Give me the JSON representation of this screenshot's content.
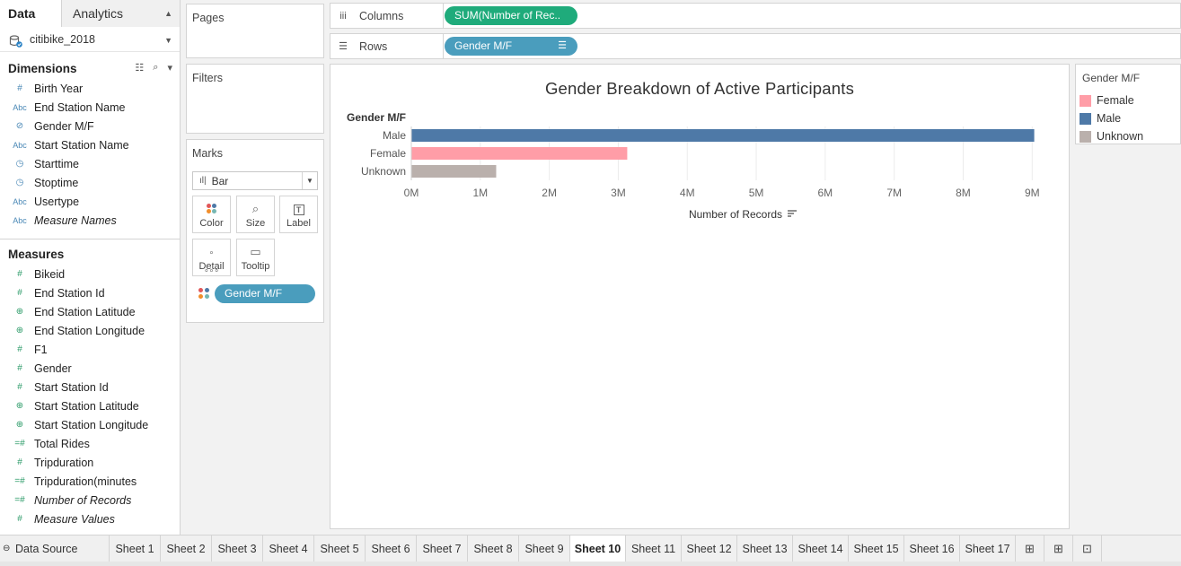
{
  "data_pane": {
    "tabs": [
      "Data",
      "Analytics"
    ],
    "datasource": "citibike_2018",
    "dimensions_title": "Dimensions",
    "dimensions": [
      {
        "icon": "#",
        "type": "number-dim",
        "label": "Birth Year",
        "italic": false
      },
      {
        "icon": "Abc",
        "type": "string",
        "label": "End Station Name",
        "italic": false
      },
      {
        "icon": "⊘",
        "type": "group",
        "label": "Gender M/F",
        "italic": false
      },
      {
        "icon": "Abc",
        "type": "string",
        "label": "Start Station Name",
        "italic": false
      },
      {
        "icon": "◷",
        "type": "datetime",
        "label": "Starttime",
        "italic": false
      },
      {
        "icon": "◷",
        "type": "datetime",
        "label": "Stoptime",
        "italic": false
      },
      {
        "icon": "Abc",
        "type": "string",
        "label": "Usertype",
        "italic": false
      },
      {
        "icon": "Abc",
        "type": "string",
        "label": "Measure Names",
        "italic": true
      }
    ],
    "measures_title": "Measures",
    "measures": [
      {
        "icon": "#",
        "type": "number",
        "label": "Bikeid",
        "italic": false
      },
      {
        "icon": "#",
        "type": "number",
        "label": "End Station Id",
        "italic": false
      },
      {
        "icon": "⊕",
        "type": "geo",
        "label": "End Station Latitude",
        "italic": false
      },
      {
        "icon": "⊕",
        "type": "geo",
        "label": "End Station Longitude",
        "italic": false
      },
      {
        "icon": "#",
        "type": "number",
        "label": "F1",
        "italic": false
      },
      {
        "icon": "#",
        "type": "number",
        "label": "Gender",
        "italic": false
      },
      {
        "icon": "#",
        "type": "number",
        "label": "Start Station Id",
        "italic": false
      },
      {
        "icon": "⊕",
        "type": "geo",
        "label": "Start Station Latitude",
        "italic": false
      },
      {
        "icon": "⊕",
        "type": "geo",
        "label": "Start Station Longitude",
        "italic": false
      },
      {
        "icon": "=#",
        "type": "calc",
        "label": "Total Rides",
        "italic": false
      },
      {
        "icon": "#",
        "type": "number",
        "label": "Tripduration",
        "italic": false
      },
      {
        "icon": "=#",
        "type": "calc",
        "label": "Tripduration(minutes",
        "italic": false
      },
      {
        "icon": "=#",
        "type": "calc",
        "label": "Number of Records",
        "italic": true
      },
      {
        "icon": "#",
        "type": "number",
        "label": "Measure Values",
        "italic": true
      }
    ]
  },
  "cards": {
    "pages": "Pages",
    "filters": "Filters",
    "marks": "Marks",
    "mark_type": "Bar",
    "mark_buttons": [
      {
        "label": "Color",
        "icon": "color-icon"
      },
      {
        "label": "Size",
        "icon": "size-icon"
      },
      {
        "label": "Label",
        "icon": "label-icon"
      },
      {
        "label": "Detail",
        "icon": "detail-icon"
      },
      {
        "label": "Tooltip",
        "icon": "tooltip-icon"
      }
    ],
    "color_pill": "Gender M/F"
  },
  "shelves": {
    "columns_label": "Columns",
    "columns_pill": "SUM(Number of Rec..",
    "rows_label": "Rows",
    "rows_pill": "Gender M/F"
  },
  "chart_data": {
    "type": "bar",
    "orientation": "horizontal",
    "title": "Gender  Breakdown of Active Participants",
    "row_header": "Gender M/F",
    "categories": [
      "Male",
      "Female",
      "Unknown"
    ],
    "values": [
      9030000,
      3130000,
      1230000
    ],
    "colors": [
      "#4e79a7",
      "#ff9da7",
      "#bab0ac"
    ],
    "xlabel": "Number of Records",
    "xlim": [
      0,
      9400000
    ],
    "x_ticks": [
      0,
      1000000,
      2000000,
      3000000,
      4000000,
      5000000,
      6000000,
      7000000,
      8000000,
      9000000
    ],
    "x_tick_labels": [
      "0M",
      "1M",
      "2M",
      "3M",
      "4M",
      "5M",
      "6M",
      "7M",
      "8M",
      "9M"
    ],
    "grid": true
  },
  "legend": {
    "title": "Gender M/F",
    "items": [
      {
        "label": "Female",
        "color": "#ff9da7"
      },
      {
        "label": "Male",
        "color": "#4e79a7"
      },
      {
        "label": "Unknown",
        "color": "#bab0ac"
      }
    ]
  },
  "tabs": {
    "data_source": "Data Source",
    "sheets": [
      "Sheet 1",
      "Sheet 2",
      "Sheet 3",
      "Sheet 4",
      "Sheet 5",
      "Sheet 6",
      "Sheet 7",
      "Sheet 8",
      "Sheet 9",
      "Sheet 10",
      "Sheet 11",
      "Sheet 12",
      "Sheet 13",
      "Sheet 14",
      "Sheet 15",
      "Sheet 16",
      "Sheet 17"
    ],
    "active": "Sheet 10"
  }
}
